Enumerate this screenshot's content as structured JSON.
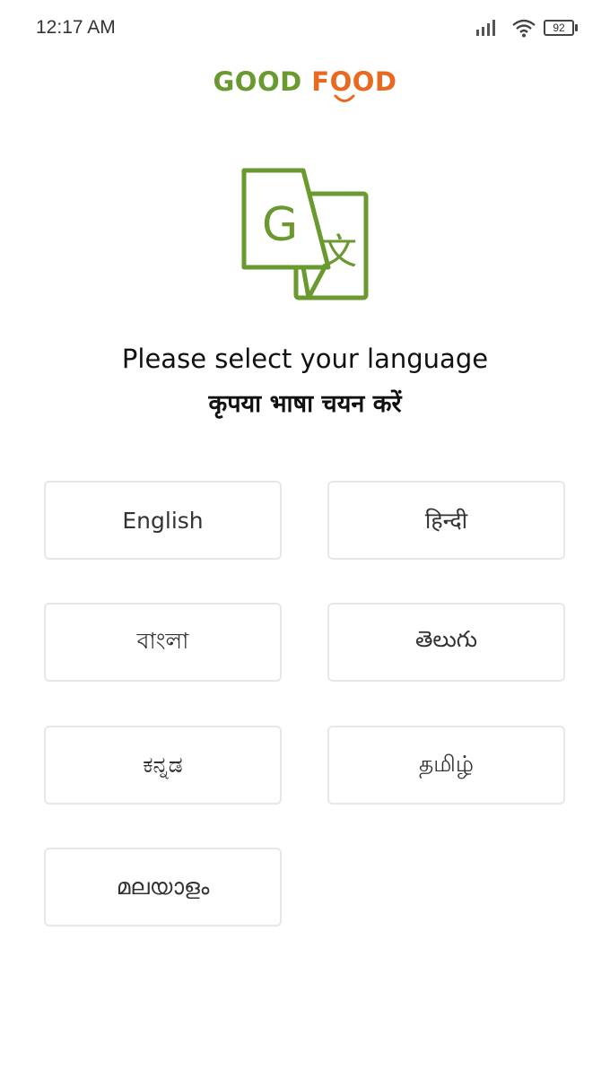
{
  "status_bar": {
    "time": "12:17 AM",
    "battery": "92",
    "icons": [
      "signal-icon",
      "wifi-icon",
      "battery-icon"
    ]
  },
  "logo": {
    "good": "GOOD",
    "food": "FOOD",
    "colors": {
      "good": "#6a9a2f",
      "food": "#e8691f"
    }
  },
  "icon": {
    "name": "translate-icon",
    "letters": [
      "G",
      "文"
    ],
    "color": "#6a9a2f"
  },
  "heading": "Please select your language",
  "subheading": "कृपया भाषा चयन करें",
  "languages": [
    {
      "label": "English"
    },
    {
      "label": "हिन्दी"
    },
    {
      "label": "বাংলা"
    },
    {
      "label": "తెలుగు"
    },
    {
      "label": "ಕನ್ನಡ"
    },
    {
      "label": "தமிழ்"
    },
    {
      "label": "മലയാളം"
    }
  ]
}
